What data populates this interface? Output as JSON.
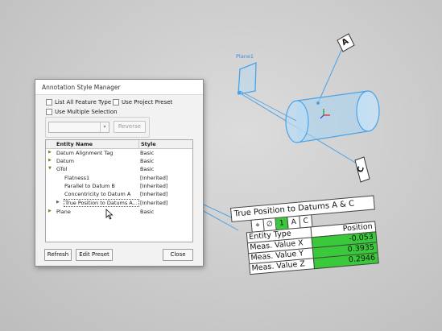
{
  "dialog": {
    "title": "Annotation Style Manager",
    "options": {
      "list_all_feature_type": "List All Feature Type",
      "use_project_preset": "Use Project Preset",
      "use_multiple_selection": "Use Multiple Selection"
    },
    "reverse_label": "Reverse",
    "table": {
      "columns": [
        "Entity Name",
        "Style"
      ],
      "rows": [
        {
          "name": "Datum Alignment Tag",
          "style": "Basic"
        },
        {
          "name": "Datum",
          "style": "Basic"
        },
        {
          "name": "GTol",
          "style": "Basic"
        },
        {
          "name": "Flatness1",
          "style": "[Inherited]"
        },
        {
          "name": "Parallel to Datum B",
          "style": "[Inherited]"
        },
        {
          "name": "Concentricity to Datum A",
          "style": "[Inherited]"
        },
        {
          "name": "True Position to Datums A...",
          "style": "[Inherited]"
        },
        {
          "name": "Plane",
          "style": "Basic"
        }
      ]
    },
    "buttons": {
      "refresh": "Refresh",
      "edit_preset": "Edit Preset",
      "close": "Close"
    }
  },
  "scene": {
    "plane_label": "Plane1",
    "datum_a": "A",
    "datum_c": "C"
  },
  "fcf": {
    "title": "True Position to Datums A & C",
    "symbols": [
      "⌖",
      "∅",
      "1",
      "A",
      "C"
    ],
    "header": "Position",
    "rows": [
      {
        "label": "Entity Type",
        "value": ""
      },
      {
        "label": "Meas. Value X",
        "value": "-0.053"
      },
      {
        "label": "Meas. Value Y",
        "value": "0.3935"
      },
      {
        "label": "Meas. Value Z",
        "value": "0.2946"
      }
    ]
  },
  "colors": {
    "accent": "#3ac93a",
    "cad_blue": "#4ba3e8"
  }
}
